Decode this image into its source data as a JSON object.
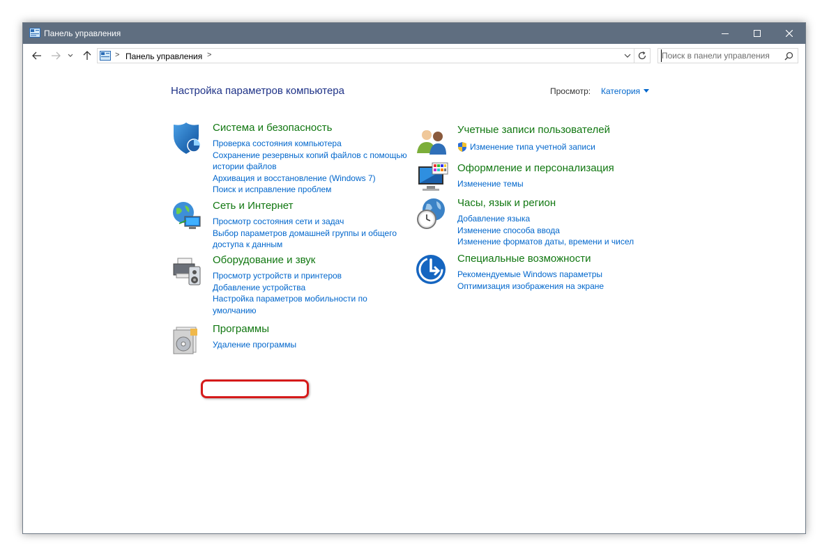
{
  "window": {
    "title": "Панель управления",
    "title_bar_color": "#5f6e80"
  },
  "address_bar": {
    "separator": ">",
    "crumb": "Панель управления",
    "search_placeholder": "Поиск в панели управления"
  },
  "header": {
    "title": "Настройка параметров компьютера",
    "view_label": "Просмотр:",
    "view_value": "Категория"
  },
  "categories": [
    {
      "heading": "Система и безопасность",
      "icon": "shield-icon",
      "links": [
        "Проверка состояния компьютера",
        "Сохранение резервных копий файлов с помощью истории файлов",
        "Архивация и восстановление (Windows 7)",
        "Поиск и исправление проблем"
      ]
    },
    {
      "heading": "Сеть и Интернет",
      "icon": "network-globe-icon",
      "links": [
        "Просмотр состояния сети и задач",
        "Выбор параметров домашней группы и общего доступа к данным"
      ]
    },
    {
      "heading": "Оборудование и звук",
      "icon": "printer-speaker-icon",
      "links": [
        "Просмотр устройств и принтеров",
        "Добавление устройства",
        "Настройка параметров мобильности по умолчанию"
      ]
    },
    {
      "heading": "Программы",
      "icon": "programs-disc-icon",
      "links": [
        "Удаление программы"
      ]
    },
    {
      "heading": "Учетные записи пользователей",
      "icon": "users-icon",
      "links": [
        "Изменение типа учетной записи"
      ]
    },
    {
      "heading": "Оформление и персонализация",
      "icon": "monitor-palette-icon",
      "links": [
        "Изменение темы"
      ]
    },
    {
      "heading": "Часы, язык и регион",
      "icon": "clock-globe-icon",
      "links": [
        "Добавление языка",
        "Изменение способа ввода",
        "Изменение форматов даты, времени и чисел"
      ]
    },
    {
      "heading": "Специальные возможности",
      "icon": "accessibility-icon",
      "links": [
        "Рекомендуемые Windows параметры",
        "Оптимизация изображения на экране"
      ]
    }
  ],
  "colors": {
    "heading_green": "#117711",
    "link_blue": "#0066cc",
    "title_blue": "#1e3287",
    "highlight_red": "#d51a1a"
  }
}
